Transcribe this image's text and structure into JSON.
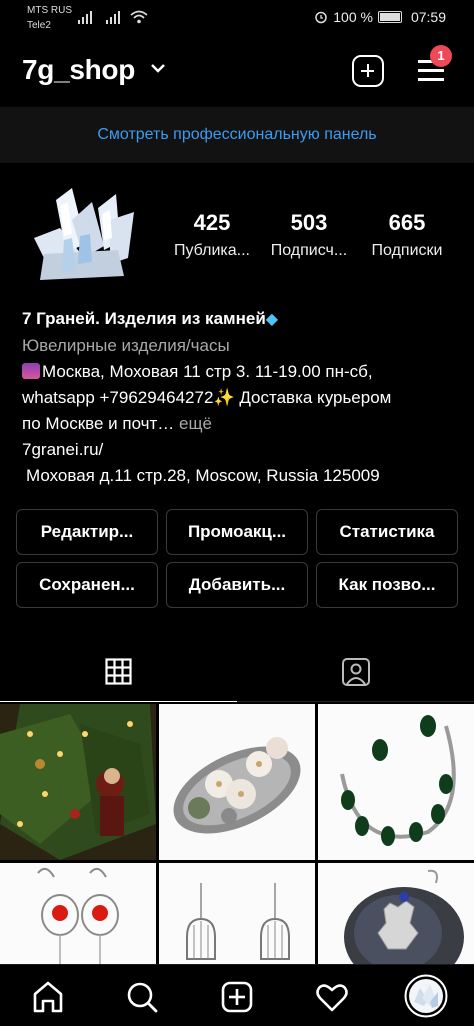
{
  "status": {
    "carrier1": "MTS RUS",
    "carrier2": "Tele2",
    "battery": "100 %",
    "time": "07:59"
  },
  "header": {
    "username": "7g_shop",
    "notification_count": "1"
  },
  "pro_panel": "Смотреть профессиональную панель",
  "stats": [
    {
      "value": "425",
      "label": "Публика..."
    },
    {
      "value": "503",
      "label": "Подписч..."
    },
    {
      "value": "665",
      "label": "Подписки"
    }
  ],
  "bio": {
    "name": "7 Граней. Изделия из камней",
    "category": "Ювелирные изделия/часы",
    "line1": "Москва, Моховая 11 стр 3. 11-19.00 пн-сб,",
    "line2": "whatsapp +79629464272",
    "line2_end": " Доставка курьером",
    "line3": "по Москве и почт…",
    "more": " ещё",
    "website": "7granei.ru/",
    "address": "Моховая д.11 стр.28, Moscow, Russia 125009"
  },
  "buttons": {
    "edit": "Редактир...",
    "promo": "Промоакц...",
    "stats": "Статистика",
    "saved": "Сохранен...",
    "add": "Добавить...",
    "how": "Как позво..."
  },
  "icons": {
    "tab_grid": "grid-icon",
    "tab_tagged": "tagged-person-icon",
    "home": "home-icon",
    "search": "search-icon",
    "create": "add-post-icon",
    "activity": "heart-icon",
    "profile": "profile-avatar"
  },
  "colors": {
    "link_blue": "#3b9cf0",
    "badge_red": "#ed4956",
    "background": "#000000"
  }
}
